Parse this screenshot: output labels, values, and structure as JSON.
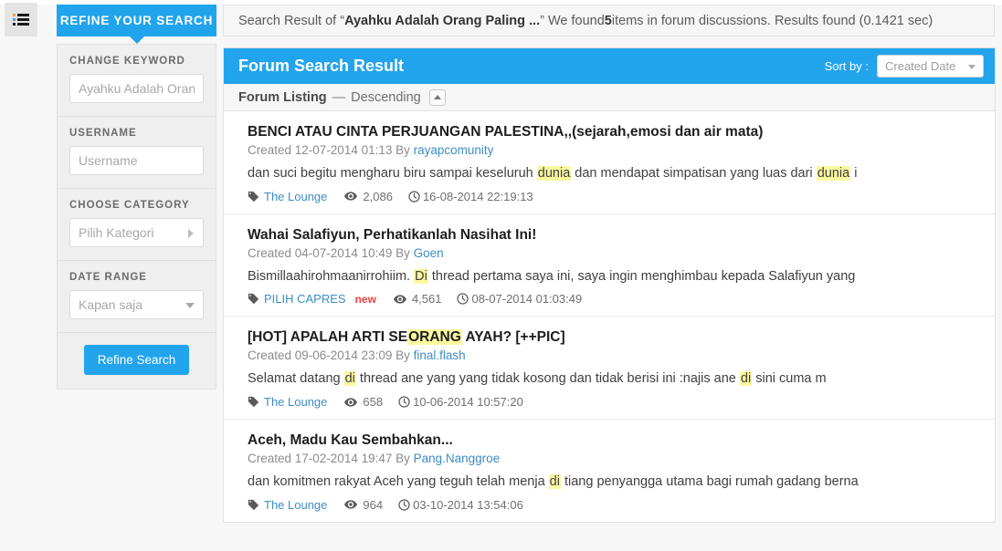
{
  "colors": {
    "accent": "#22a4ed",
    "highlight": "#fbf8a0",
    "link": "#3c8dc5",
    "badge_new": "#e8433c"
  },
  "topbar": {
    "menu_icon": "list-menu-icon",
    "refine_tab_label": "REFINE YOUR SEARCH",
    "summary_prefix": "Search Result of “",
    "summary_query": "Ayahku Adalah Orang Paling ...",
    "summary_mid": "” We found ",
    "summary_count": "5",
    "summary_suffix": " items in forum discussions. Results found (0.1421 sec)"
  },
  "sidebar": {
    "groups": [
      {
        "label": "CHANGE KEYWORD",
        "control": "input",
        "value": "",
        "placeholder": "Ayahku Adalah Oran"
      },
      {
        "label": "USERNAME",
        "control": "input",
        "value": "",
        "placeholder": "Username"
      },
      {
        "label": "CHOOSE CATEGORY",
        "control": "select-right",
        "value": "Pilih Kategori"
      },
      {
        "label": "DATE RANGE",
        "control": "select-down",
        "value": "Kapan saja"
      }
    ],
    "submit_label": "Refine Search"
  },
  "results_panel": {
    "title": "Forum Search Result",
    "sort_label": "Sort by :",
    "sort_value": "Created Date",
    "listing_label": "Forum Listing",
    "listing_dash": "—",
    "listing_order": "Descending",
    "sort_direction_icon": "caret-up-icon"
  },
  "items": [
    {
      "title": "BENCI ATAU CINTA PERJUANGAN PALESTINA,,(sejarah,emosi dan air mata)",
      "created_prefix": "Created 12-07-2014 01:13 By ",
      "author": "rayapcomunity",
      "snippet_parts": [
        {
          "text": "dan suci begitu mengharu biru sampai keseluruh ",
          "hl": false
        },
        {
          "text": "dunia",
          "hl": true
        },
        {
          "text": " dan mendapat simpatisan yang luas dari ",
          "hl": false
        },
        {
          "text": "dunia",
          "hl": true
        },
        {
          "text": " i",
          "hl": false
        }
      ],
      "category": "The Lounge",
      "is_new": false,
      "views": "2,086",
      "date": "16-08-2014 22:19:13"
    },
    {
      "title": "Wahai Salafiyun, Perhatikanlah Nasihat Ini!",
      "created_prefix": "Created 04-07-2014 10:49 By ",
      "author": "Goen",
      "snippet_parts": [
        {
          "text": "Bismillaahirohmaanirrohiim. ",
          "hl": false
        },
        {
          "text": "Di",
          "hl": true
        },
        {
          "text": " thread pertama saya ini, saya ingin menghimbau kepada Salafiyun yang",
          "hl": false
        }
      ],
      "category": "PILIH CAPRES",
      "is_new": true,
      "new_label": "new",
      "views": "4,561",
      "date": "08-07-2014 01:03:49"
    },
    {
      "title_parts": [
        {
          "text": "[HOT] APALAH ARTI SE",
          "hl": false
        },
        {
          "text": "ORANG",
          "hl": true
        },
        {
          "text": " AYAH? [++PIC]",
          "hl": false
        }
      ],
      "title": "[HOT] APALAH ARTI SE ORANG AYAH? [++PIC]",
      "created_prefix": "Created 09-06-2014 23:09 By ",
      "author": "final.flash",
      "snippet_parts": [
        {
          "text": "Selamat datang ",
          "hl": false
        },
        {
          "text": "di",
          "hl": true
        },
        {
          "text": " thread ane yang yang tidak kosong dan tidak berisi ini :najis ane ",
          "hl": false
        },
        {
          "text": "di",
          "hl": true
        },
        {
          "text": " sini cuma m",
          "hl": false
        }
      ],
      "category": "The Lounge",
      "is_new": false,
      "views": "658",
      "date": "10-06-2014 10:57:20"
    },
    {
      "title": "Aceh, Madu Kau Sembahkan...",
      "created_prefix": "Created 17-02-2014 19:47 By ",
      "author": "Pang.Nanggroe",
      "snippet_parts": [
        {
          "text": "dan komitmen rakyat Aceh yang teguh telah menja ",
          "hl": false
        },
        {
          "text": "di",
          "hl": true
        },
        {
          "text": " tiang penyangga utama bagi rumah gadang berna",
          "hl": false
        }
      ],
      "category": "The Lounge",
      "is_new": false,
      "views": "964",
      "date": "03-10-2014 13:54:06"
    }
  ],
  "icons": {
    "tag": "tag-icon",
    "views": "eye-icon",
    "date": "clock-icon"
  }
}
